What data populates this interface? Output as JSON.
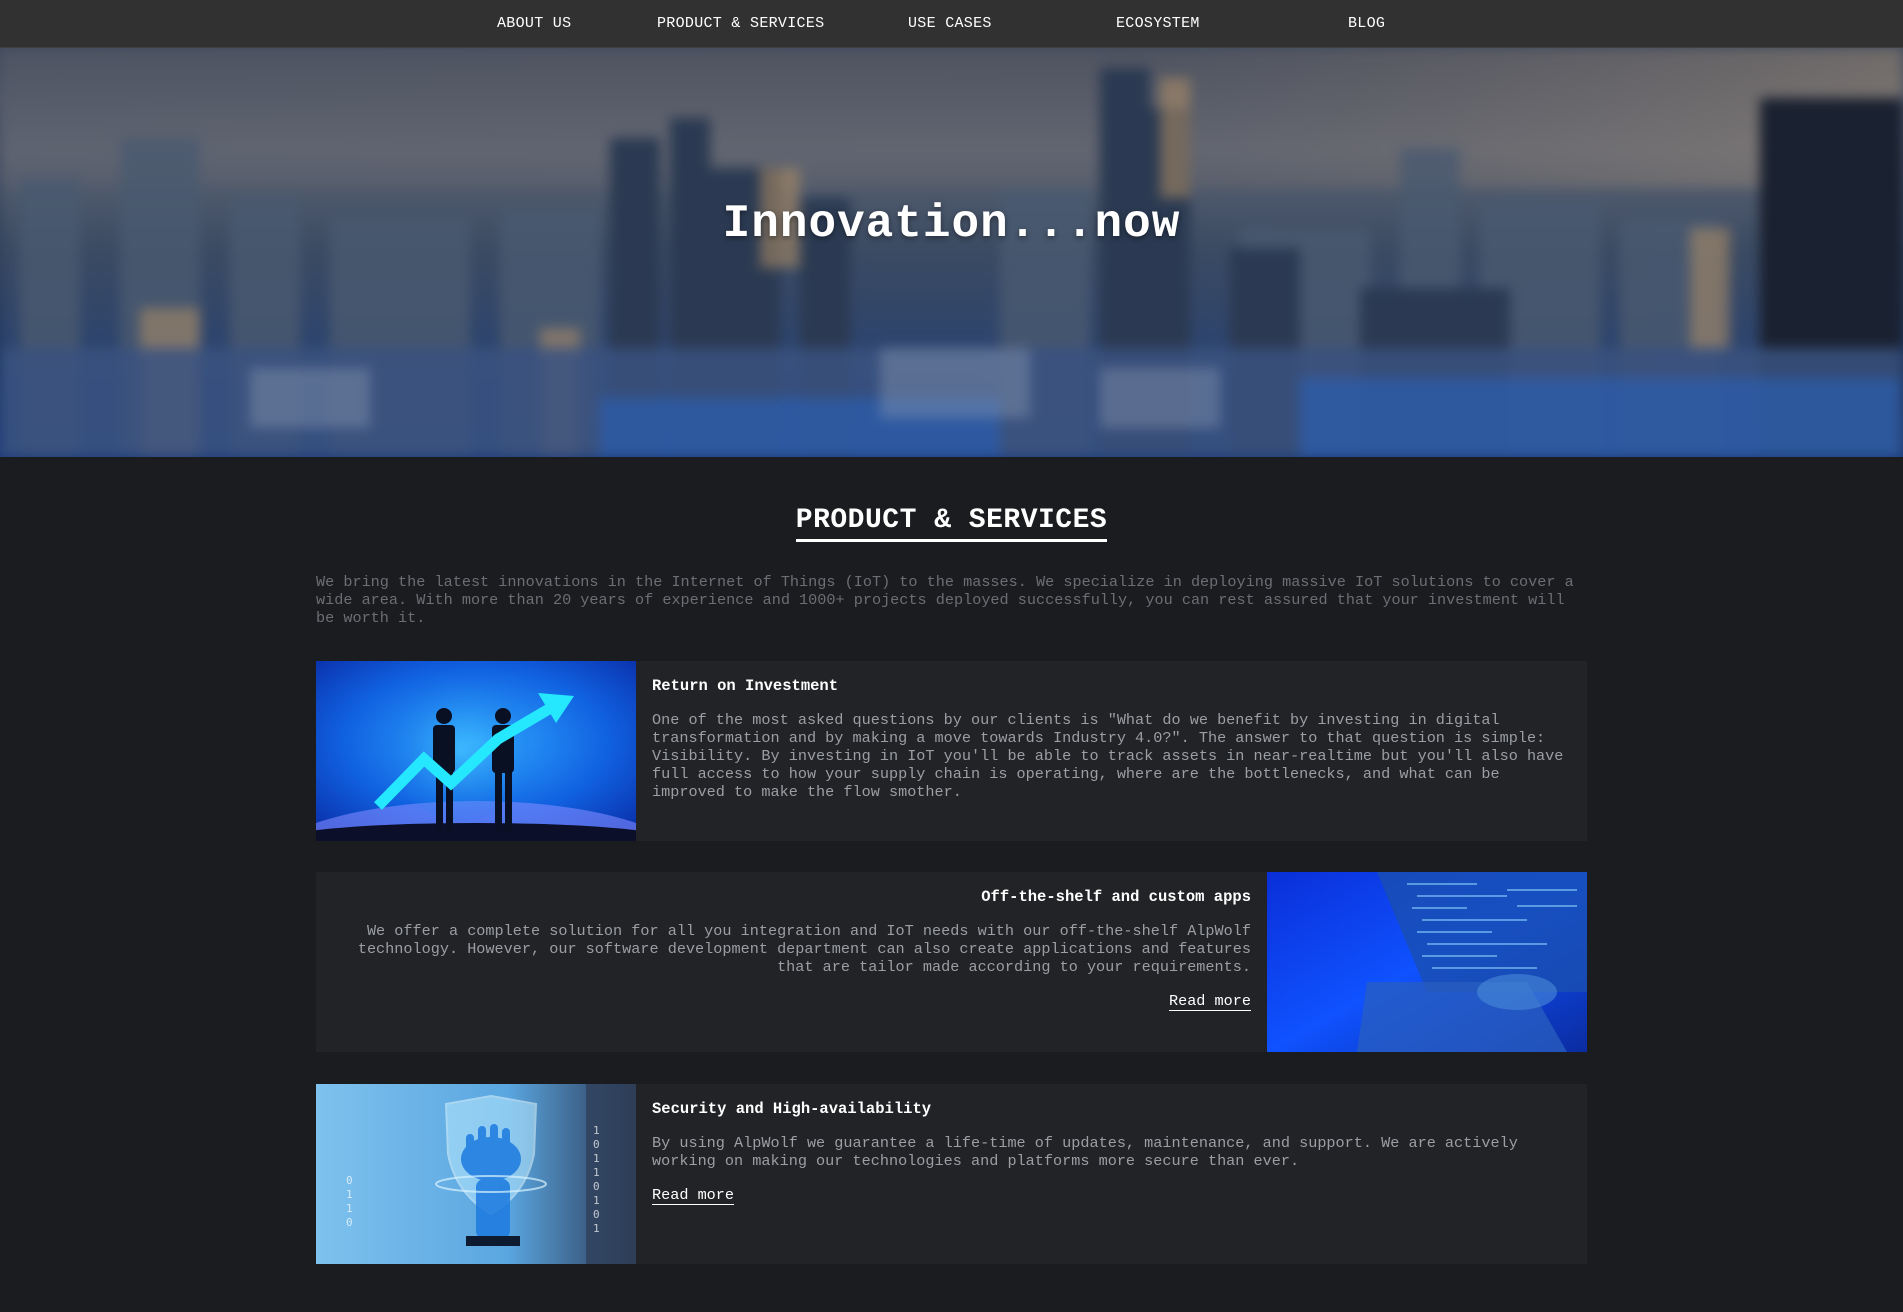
{
  "nav": {
    "items": [
      {
        "label": "ABOUT US"
      },
      {
        "label": "PRODUCT & SERVICES"
      },
      {
        "label": "USE CASES"
      },
      {
        "label": "ECOSYSTEM"
      },
      {
        "label": "BLOG"
      }
    ]
  },
  "hero": {
    "title": "Innovation...now"
  },
  "section": {
    "title": "PRODUCT & SERVICES",
    "intro": "We bring the latest innovations in the Internet of Things (IoT) to the masses. We specialize in deploying massive IoT solutions to cover a wide area. With more than 20 years of experience and 1000+ projects deployed successfully, you can rest assured that your investment will be worth it."
  },
  "cards": [
    {
      "title": "Return on Investment",
      "text": "One of the most asked questions by our clients is \"What do we benefit by investing in digital transformation and by making a move towards Industry 4.0?\". The answer to that question is simple: Visibility. By investing in IoT you'll be able to track assets in near-realtime but you'll also have full access to how your supply chain is operating, where are the bottlenecks, and what can be improved to make the flow smother."
    },
    {
      "title": "Off-the-shelf and custom apps",
      "text": "We offer a complete solution for all you integration and IoT needs with our off-the-shelf AlpWolf technology. However, our software development department can also create applications and features that are tailor made according to your requirements.",
      "link": "Read more"
    },
    {
      "title": "Security and High-availability",
      "text": "By using AlpWolf we guarantee a life-time of updates, maintenance, and support. We are actively working on making our technologies and platforms more secure than ever.",
      "link": "Read more"
    }
  ]
}
